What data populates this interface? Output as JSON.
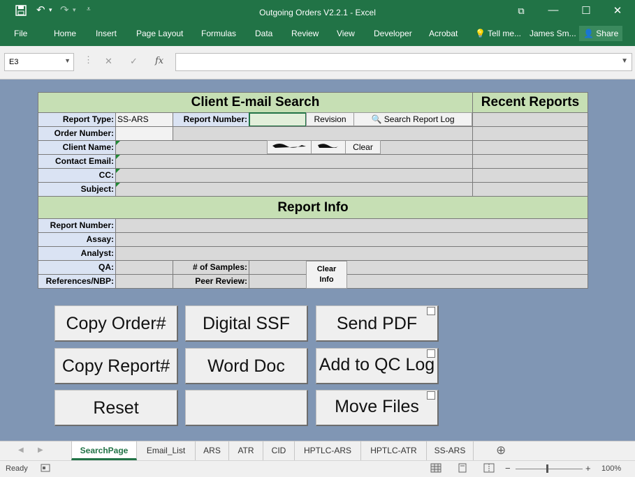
{
  "window": {
    "title": "Outgoing Orders V2.2.1 - Excel",
    "user": "James Sm...",
    "share_label": "Share",
    "tell_me": "Tell me..."
  },
  "ribbon_tabs": [
    "File",
    "Home",
    "Insert",
    "Page Layout",
    "Formulas",
    "Data",
    "Review",
    "View",
    "Developer",
    "Acrobat"
  ],
  "formula_bar": {
    "name_box": "E3",
    "formula": ""
  },
  "search_panel": {
    "header": "Client E-mail Search",
    "recent_header": "Recent Reports",
    "report_type_label": "Report Type:",
    "report_type_value": "SS-ARS",
    "report_number_label": "Report Number:",
    "revision_button": "Revision",
    "search_log_button": "Search Report Log",
    "order_number_label": "Order Number:",
    "client_name_label": "Client Name:",
    "clear_button": "Clear",
    "contact_email_label": "Contact Email:",
    "cc_label": "CC:",
    "subject_label": "Subject:"
  },
  "report_info": {
    "header": "Report Info",
    "report_number_label": "Report Number:",
    "assay_label": "Assay:",
    "analyst_label": "Analyst:",
    "qa_label": "QA:",
    "samples_label": "# of Samples:",
    "clear_info_line1": "Clear",
    "clear_info_line2": "Info",
    "references_label": "References/NBP:",
    "peer_review_label": "Peer Review:"
  },
  "action_buttons": {
    "copy_order": "Copy Order#",
    "digital_ssf": "Digital SSF",
    "send_pdf": "Send PDF",
    "copy_report": "Copy Report#",
    "word_doc": "Word Doc",
    "add_qc_log": "Add to QC Log",
    "reset": "Reset",
    "blank": "",
    "move_files": "Move Files"
  },
  "sheet_tabs": [
    "SearchPage",
    "Email_List",
    "ARS",
    "ATR",
    "CID",
    "HPTLC-ARS",
    "HPTLC-ATR",
    "SS-ARS"
  ],
  "active_sheet": "SearchPage",
  "status": {
    "ready": "Ready",
    "zoom": "100%"
  },
  "colors": {
    "accent": "#217346",
    "header_fill": "#c6dfb4",
    "label_fill": "#dae3f3",
    "sheet_bg": "#8096b4"
  }
}
